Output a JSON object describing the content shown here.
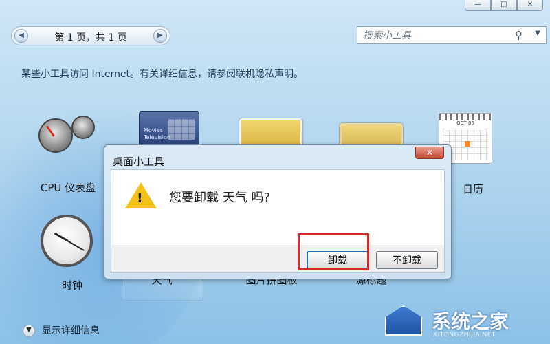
{
  "window": {
    "minimize_icon": "minimize-icon",
    "maximize_icon": "maximize-icon",
    "close_icon": "close-icon"
  },
  "pager": {
    "text": "第 1 页，共 1 页",
    "prev_icon": "chevron-left-icon",
    "next_icon": "chevron-right-icon"
  },
  "search": {
    "placeholder": "搜索小工具",
    "icon": "search-icon",
    "dropdown_icon": "chevron-down-icon"
  },
  "notice": "某些小工具访问 Internet。有关详细信息，请参阅联机隐私声明。",
  "gadgets": [
    {
      "label": "CPU 仪表盘"
    },
    {
      "label": "Movies\nTelevision"
    },
    {
      "label": ""
    },
    {
      "label": ""
    },
    {
      "label": "日历",
      "calendar_month": "OCT 06"
    },
    {
      "label": "时钟"
    },
    {
      "label": "天气"
    },
    {
      "label": "图片拼图板"
    },
    {
      "label": "源标题"
    }
  ],
  "dialog": {
    "title": "桌面小工具",
    "message": "您要卸载 天气 吗?",
    "buttons": {
      "uninstall": "卸载",
      "keep": "不卸载"
    },
    "warning_icon": "warning-icon",
    "close_icon": "close-icon"
  },
  "footer": {
    "show_details": "显示详细信息",
    "chevron_icon": "chevron-down-icon"
  },
  "watermark": {
    "brand": "系统之家",
    "url": "XITONGZHIJIA.NET"
  },
  "colors": {
    "background": "#bcdcf1",
    "dialog_bg": "#d6e7f5",
    "highlight_red": "#d52a2a",
    "primary_blue": "#2a6fbf"
  }
}
